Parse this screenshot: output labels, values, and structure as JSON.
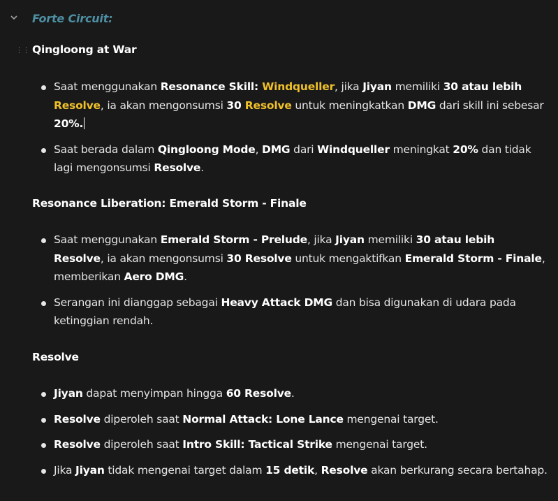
{
  "toggle": {
    "heading": "Forte Circuit:"
  },
  "sections": [
    {
      "title": "Qingloong at War",
      "bullets": [
        {
          "t": [
            "Saat menggunakan ",
            "Resonance Skill: ",
            "Windqueller",
            ", jika ",
            "Jiyan",
            " memiliki ",
            "30 atau lebih",
            " ",
            "Resolve",
            ", ia akan mengonsumsi ",
            "30 ",
            "Resolve",
            " untuk meningkatkan ",
            "DMG",
            " dari skill ini sebesar ",
            "20%."
          ]
        },
        {
          "t": [
            "Saat berada dalam ",
            "Qingloong Mode",
            ", ",
            "DMG",
            " dari ",
            "Windqueller",
            " meningkat ",
            "20%",
            " dan tidak lagi mengonsumsi ",
            "Resolve",
            "."
          ]
        }
      ]
    },
    {
      "title": "Resonance Liberation: Emerald Storm - Finale",
      "bullets": [
        {
          "t": [
            "Saat menggunakan ",
            "Emerald Storm - Prelude",
            ", jika ",
            "Jiyan",
            " memiliki ",
            "30 atau lebih Resolve",
            ", ia akan mengonsumsi ",
            "30 Resolve",
            " untuk mengaktifkan ",
            "Emerald Storm - Finale",
            ", memberikan ",
            "Aero DMG",
            "."
          ]
        },
        {
          "t": [
            "Serangan ini dianggap sebagai ",
            "Heavy Attack DMG",
            " dan bisa digunakan di udara pada ketinggian rendah."
          ]
        }
      ]
    },
    {
      "title": "Resolve",
      "bullets": [
        {
          "t": [
            "Jiyan",
            " dapat menyimpan hingga ",
            "60 Resolve",
            "."
          ]
        },
        {
          "t": [
            "Resolve",
            " diperoleh saat ",
            "Normal Attack: Lone Lance",
            " mengenai target."
          ]
        },
        {
          "t": [
            "Resolve",
            " diperoleh saat ",
            "Intro Skill: Tactical Strike",
            " mengenai target."
          ]
        },
        {
          "t": [
            "Jika ",
            "Jiyan",
            " tidak mengenai target dalam ",
            "15 detik",
            ", ",
            "Resolve",
            " akan berkurang secara bertahap."
          ]
        }
      ]
    }
  ],
  "colors": {
    "background": "#191919",
    "heading": "#4d8fa3",
    "highlight": "#f0c02a",
    "text": "#e6e6e6"
  },
  "icons": {
    "toggle": "chevron-down-icon",
    "drag": "drag-handle-icon"
  }
}
